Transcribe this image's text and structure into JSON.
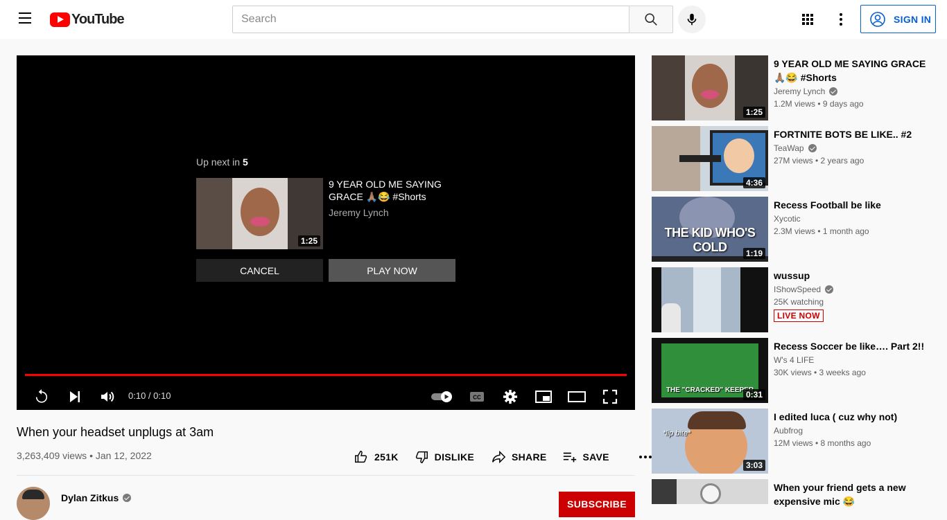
{
  "header": {
    "logo_text": "YouTube",
    "search_placeholder": "Search",
    "signin_label": "SIGN IN"
  },
  "player": {
    "upnext_prefix": "Up next in",
    "upnext_countdown": "5",
    "upnext_title": "9 YEAR OLD ME SAYING GRACE 🙏🏽😂 #Shorts",
    "upnext_channel": "Jeremy Lynch",
    "upnext_duration": "1:25",
    "cancel_label": "CANCEL",
    "play_now_label": "PLAY NOW",
    "time_display": "0:10 / 0:10",
    "progress_fraction": 1.0
  },
  "video": {
    "title": "When your headset unplugs at 3am",
    "meta": "3,263,409 views • Jan 12, 2022",
    "like_count": "251K",
    "dislike_label": "DISLIKE",
    "share_label": "SHARE",
    "save_label": "SAVE",
    "channel_name": "Dylan Zitkus",
    "subscribe_label": "SUBSCRIBE"
  },
  "recommendations": [
    {
      "title": "9 YEAR OLD ME SAYING GRACE 🙏🏽😂 #Shorts",
      "channel": "Jeremy Lynch",
      "verified": true,
      "stats": "1.2M views • 9 days ago",
      "duration": "1:25",
      "thumb_color": "#6a6a6a"
    },
    {
      "title": "FORTNITE BOTS BE LIKE.. #2",
      "channel": "TeaWap",
      "verified": true,
      "stats": "27M views • 2 years ago",
      "duration": "4:36",
      "thumb_color": "#3a78b8"
    },
    {
      "title": "Recess Football be like",
      "channel": "Xycotic",
      "verified": false,
      "stats": "2.3M views • 1 month ago",
      "duration": "1:19",
      "thumb_color": "#3c4a7a",
      "thumb_text": "THE KID WHO'S COLD"
    },
    {
      "title": "wussup",
      "channel": "IShowSpeed",
      "verified": true,
      "stats": "25K watching",
      "live": "LIVE NOW",
      "thumb_color": "#8fa4b8"
    },
    {
      "title": "Recess Soccer be like…. Part 2!!",
      "channel": "W's 4 LIFE",
      "verified": false,
      "stats": "30K views • 3 weeks ago",
      "duration": "0:31",
      "thumb_color": "#2f8f3a",
      "thumb_text": "THE \"CRACKED\" KEEPER"
    },
    {
      "title": "I edited luca ( cuz why not)",
      "channel": "Aubfrog",
      "verified": false,
      "stats": "12M views • 8 months ago",
      "duration": "3:03",
      "thumb_color": "#d9a06a",
      "thumb_text": "*lip bite*"
    },
    {
      "title": "When your friend gets a new expensive mic 😂",
      "channel": "",
      "verified": false,
      "stats": "",
      "thumb_color": "#d8d8d8"
    }
  ]
}
